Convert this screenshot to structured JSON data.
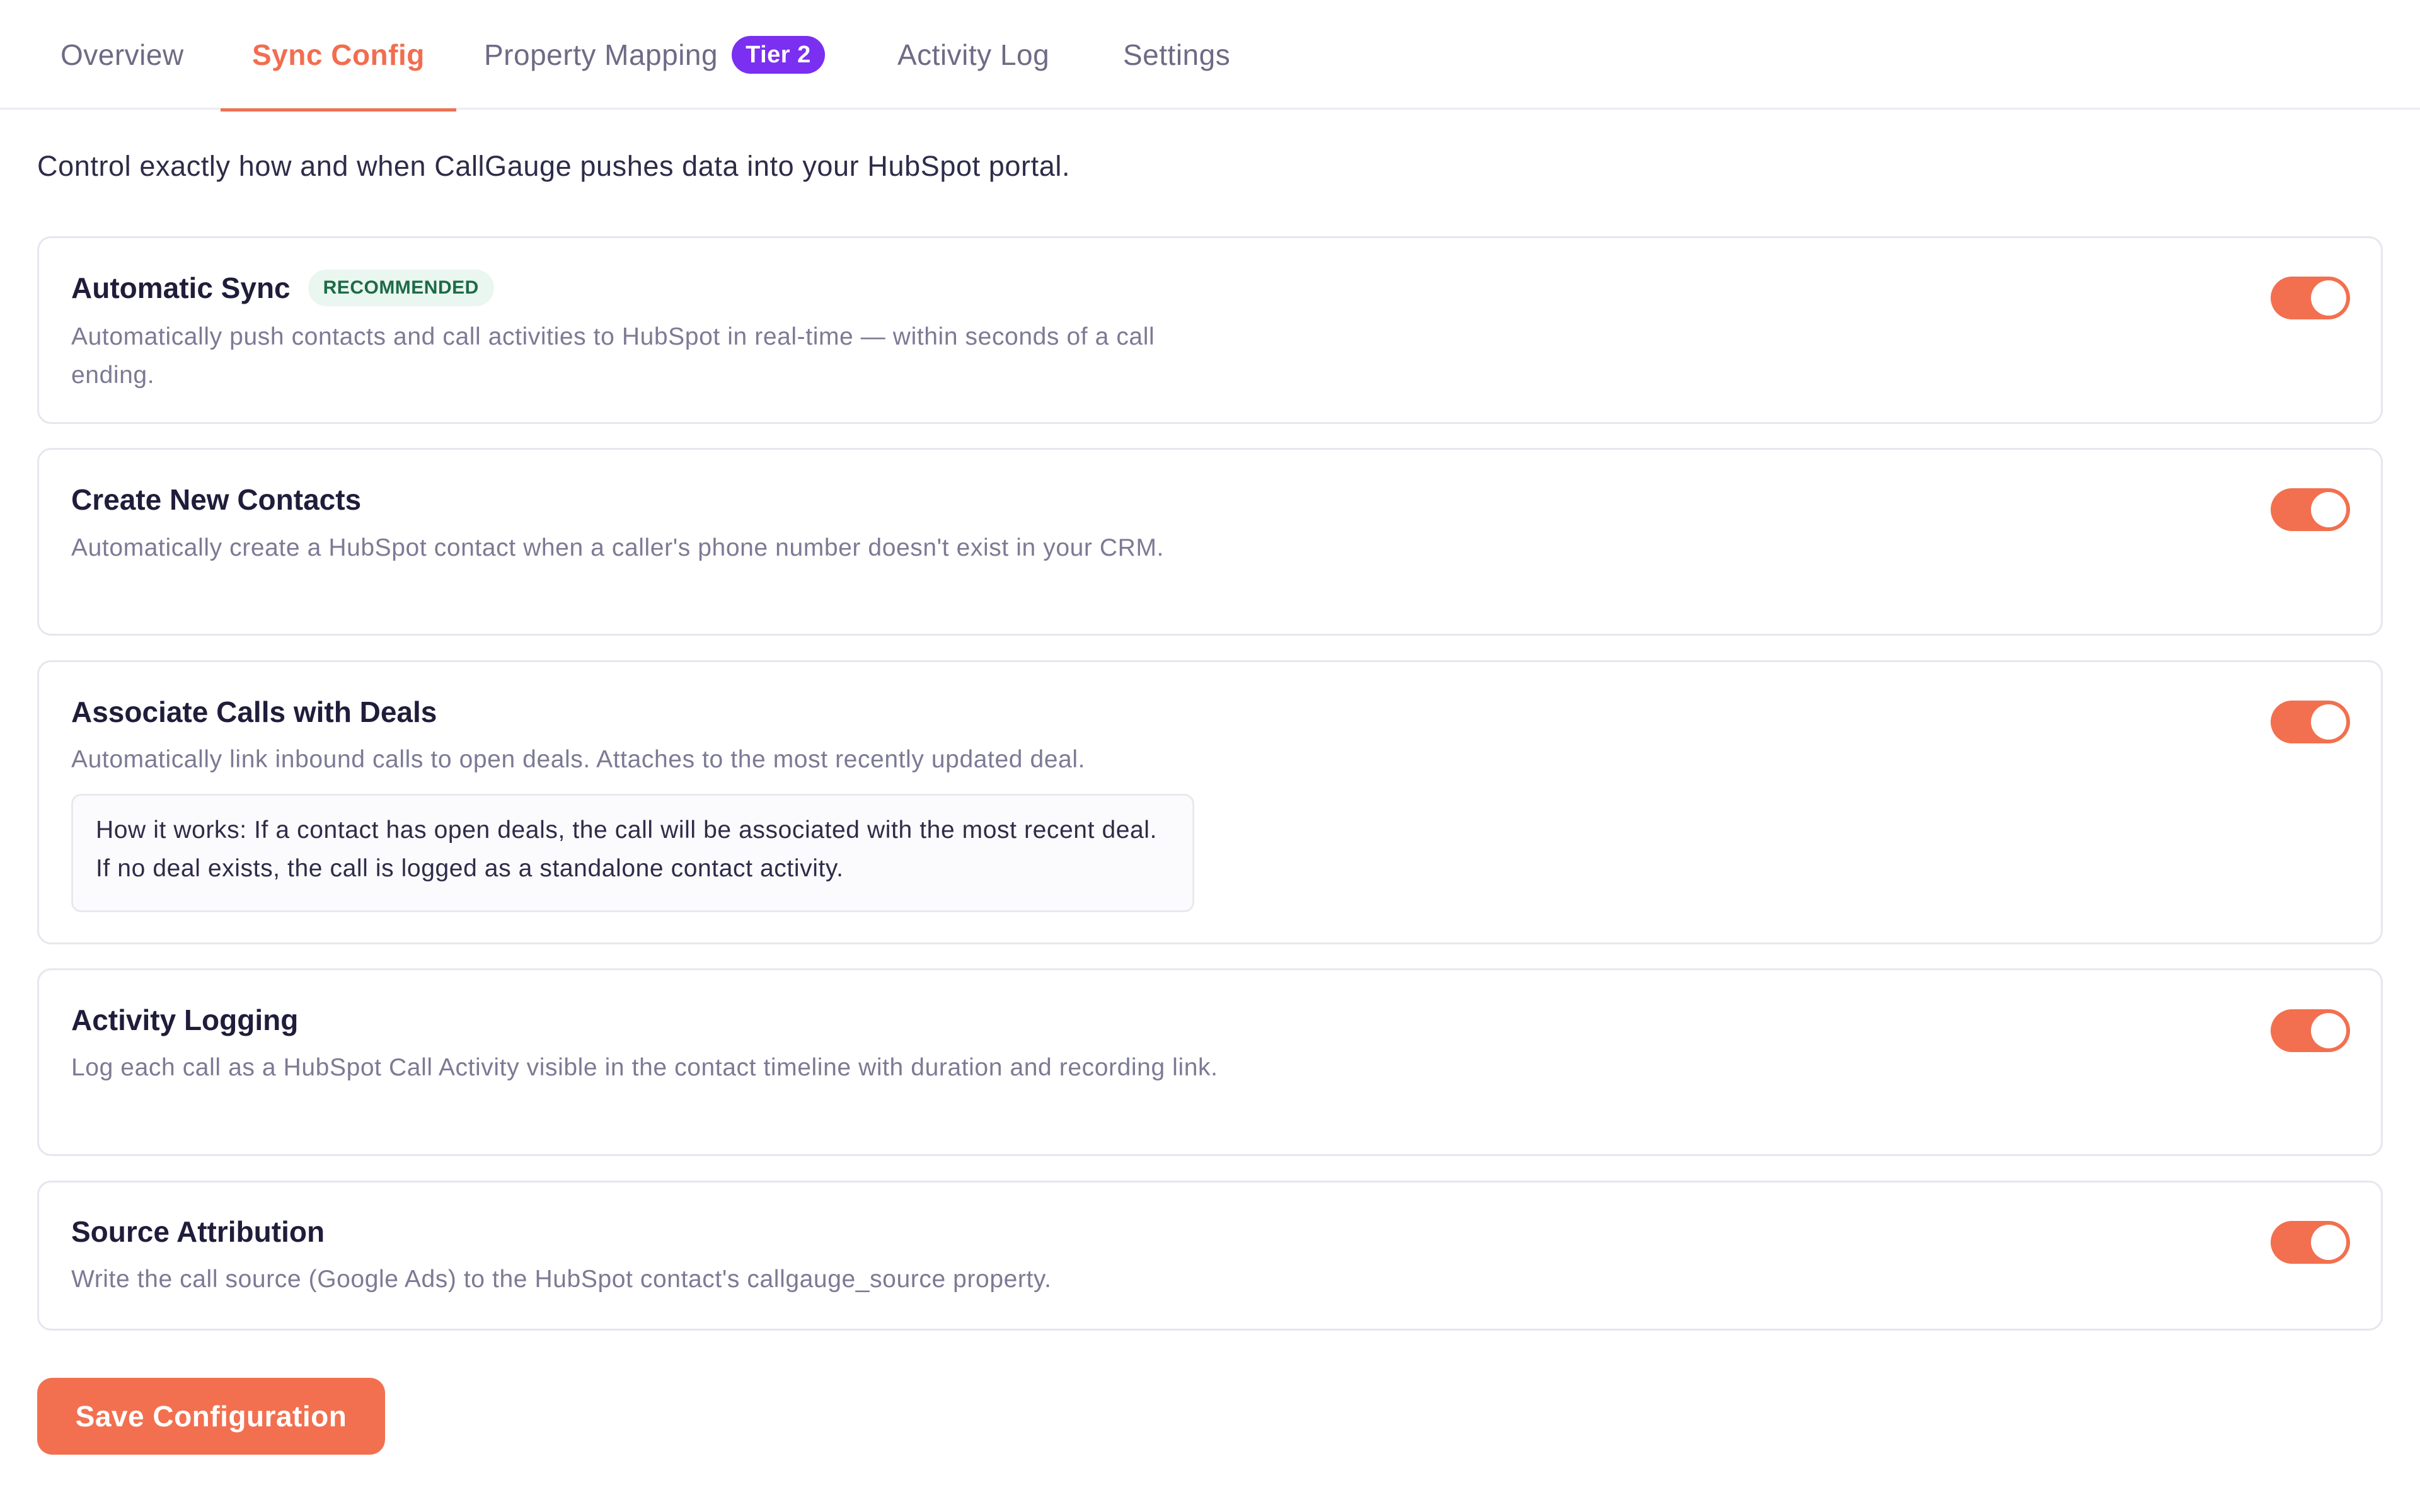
{
  "tabs": [
    {
      "label": "Overview",
      "active": false
    },
    {
      "label": "Sync Config",
      "active": true
    },
    {
      "label": "Property Mapping",
      "active": false,
      "badge": "Tier 2"
    },
    {
      "label": "Activity Log",
      "active": false
    },
    {
      "label": "Settings",
      "active": false
    }
  ],
  "intro": "Control exactly how and when CallGauge pushes data into your HubSpot portal.",
  "settings": [
    {
      "title": "Automatic Sync",
      "badge": "RECOMMENDED",
      "description": "Automatically push contacts and call activities to HubSpot in real-time — within seconds of a call ending.",
      "enabled": true
    },
    {
      "title": "Create New Contacts",
      "description": "Automatically create a HubSpot contact when a caller's phone number doesn't exist in your CRM.",
      "enabled": true
    },
    {
      "title": "Associate Calls with Deals",
      "description": "Automatically link inbound calls to open deals. Attaches to the most recently updated deal.",
      "info": "How it works: If a contact has open deals, the call will be associated with the most recent deal. If no deal exists, the call is logged as a standalone contact activity.",
      "enabled": true
    },
    {
      "title": "Activity Logging",
      "description": "Log each call as a HubSpot Call Activity visible in the contact timeline with duration and recording link.",
      "enabled": true
    },
    {
      "title": "Source Attribution",
      "description": "Write the call source (Google Ads) to the HubSpot contact's callgauge_source property.",
      "enabled": true
    }
  ],
  "save_button": "Save Configuration",
  "colors": {
    "accent": "#f2704f",
    "tier_badge": "#7b2ff0",
    "recommended_bg": "#eaf6f0",
    "recommended_text": "#1d6b45"
  }
}
